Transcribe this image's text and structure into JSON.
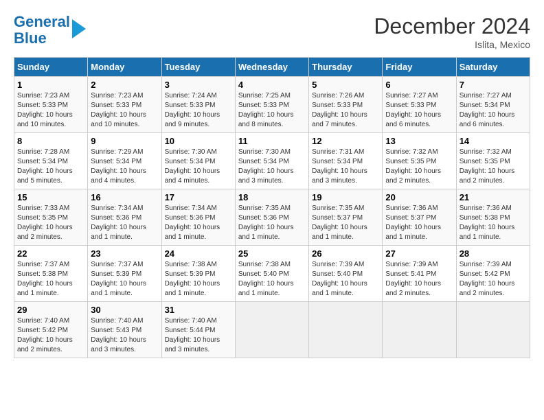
{
  "logo": {
    "line1": "General",
    "line2": "Blue"
  },
  "title": "December 2024",
  "subtitle": "Islita, Mexico",
  "weekdays": [
    "Sunday",
    "Monday",
    "Tuesday",
    "Wednesday",
    "Thursday",
    "Friday",
    "Saturday"
  ],
  "weeks": [
    [
      {
        "day": "1",
        "sunrise": "7:23 AM",
        "sunset": "5:33 PM",
        "daylight": "10 hours and 10 minutes."
      },
      {
        "day": "2",
        "sunrise": "7:23 AM",
        "sunset": "5:33 PM",
        "daylight": "10 hours and 10 minutes."
      },
      {
        "day": "3",
        "sunrise": "7:24 AM",
        "sunset": "5:33 PM",
        "daylight": "10 hours and 9 minutes."
      },
      {
        "day": "4",
        "sunrise": "7:25 AM",
        "sunset": "5:33 PM",
        "daylight": "10 hours and 8 minutes."
      },
      {
        "day": "5",
        "sunrise": "7:26 AM",
        "sunset": "5:33 PM",
        "daylight": "10 hours and 7 minutes."
      },
      {
        "day": "6",
        "sunrise": "7:27 AM",
        "sunset": "5:33 PM",
        "daylight": "10 hours and 6 minutes."
      },
      {
        "day": "7",
        "sunrise": "7:27 AM",
        "sunset": "5:34 PM",
        "daylight": "10 hours and 6 minutes."
      }
    ],
    [
      {
        "day": "8",
        "sunrise": "7:28 AM",
        "sunset": "5:34 PM",
        "daylight": "10 hours and 5 minutes."
      },
      {
        "day": "9",
        "sunrise": "7:29 AM",
        "sunset": "5:34 PM",
        "daylight": "10 hours and 4 minutes."
      },
      {
        "day": "10",
        "sunrise": "7:30 AM",
        "sunset": "5:34 PM",
        "daylight": "10 hours and 4 minutes."
      },
      {
        "day": "11",
        "sunrise": "7:30 AM",
        "sunset": "5:34 PM",
        "daylight": "10 hours and 3 minutes."
      },
      {
        "day": "12",
        "sunrise": "7:31 AM",
        "sunset": "5:34 PM",
        "daylight": "10 hours and 3 minutes."
      },
      {
        "day": "13",
        "sunrise": "7:32 AM",
        "sunset": "5:35 PM",
        "daylight": "10 hours and 2 minutes."
      },
      {
        "day": "14",
        "sunrise": "7:32 AM",
        "sunset": "5:35 PM",
        "daylight": "10 hours and 2 minutes."
      }
    ],
    [
      {
        "day": "15",
        "sunrise": "7:33 AM",
        "sunset": "5:35 PM",
        "daylight": "10 hours and 2 minutes."
      },
      {
        "day": "16",
        "sunrise": "7:34 AM",
        "sunset": "5:36 PM",
        "daylight": "10 hours and 1 minute."
      },
      {
        "day": "17",
        "sunrise": "7:34 AM",
        "sunset": "5:36 PM",
        "daylight": "10 hours and 1 minute."
      },
      {
        "day": "18",
        "sunrise": "7:35 AM",
        "sunset": "5:36 PM",
        "daylight": "10 hours and 1 minute."
      },
      {
        "day": "19",
        "sunrise": "7:35 AM",
        "sunset": "5:37 PM",
        "daylight": "10 hours and 1 minute."
      },
      {
        "day": "20",
        "sunrise": "7:36 AM",
        "sunset": "5:37 PM",
        "daylight": "10 hours and 1 minute."
      },
      {
        "day": "21",
        "sunrise": "7:36 AM",
        "sunset": "5:38 PM",
        "daylight": "10 hours and 1 minute."
      }
    ],
    [
      {
        "day": "22",
        "sunrise": "7:37 AM",
        "sunset": "5:38 PM",
        "daylight": "10 hours and 1 minute."
      },
      {
        "day": "23",
        "sunrise": "7:37 AM",
        "sunset": "5:39 PM",
        "daylight": "10 hours and 1 minute."
      },
      {
        "day": "24",
        "sunrise": "7:38 AM",
        "sunset": "5:39 PM",
        "daylight": "10 hours and 1 minute."
      },
      {
        "day": "25",
        "sunrise": "7:38 AM",
        "sunset": "5:40 PM",
        "daylight": "10 hours and 1 minute."
      },
      {
        "day": "26",
        "sunrise": "7:39 AM",
        "sunset": "5:40 PM",
        "daylight": "10 hours and 1 minute."
      },
      {
        "day": "27",
        "sunrise": "7:39 AM",
        "sunset": "5:41 PM",
        "daylight": "10 hours and 2 minutes."
      },
      {
        "day": "28",
        "sunrise": "7:39 AM",
        "sunset": "5:42 PM",
        "daylight": "10 hours and 2 minutes."
      }
    ],
    [
      {
        "day": "29",
        "sunrise": "7:40 AM",
        "sunset": "5:42 PM",
        "daylight": "10 hours and 2 minutes."
      },
      {
        "day": "30",
        "sunrise": "7:40 AM",
        "sunset": "5:43 PM",
        "daylight": "10 hours and 3 minutes."
      },
      {
        "day": "31",
        "sunrise": "7:40 AM",
        "sunset": "5:44 PM",
        "daylight": "10 hours and 3 minutes."
      },
      null,
      null,
      null,
      null
    ]
  ]
}
